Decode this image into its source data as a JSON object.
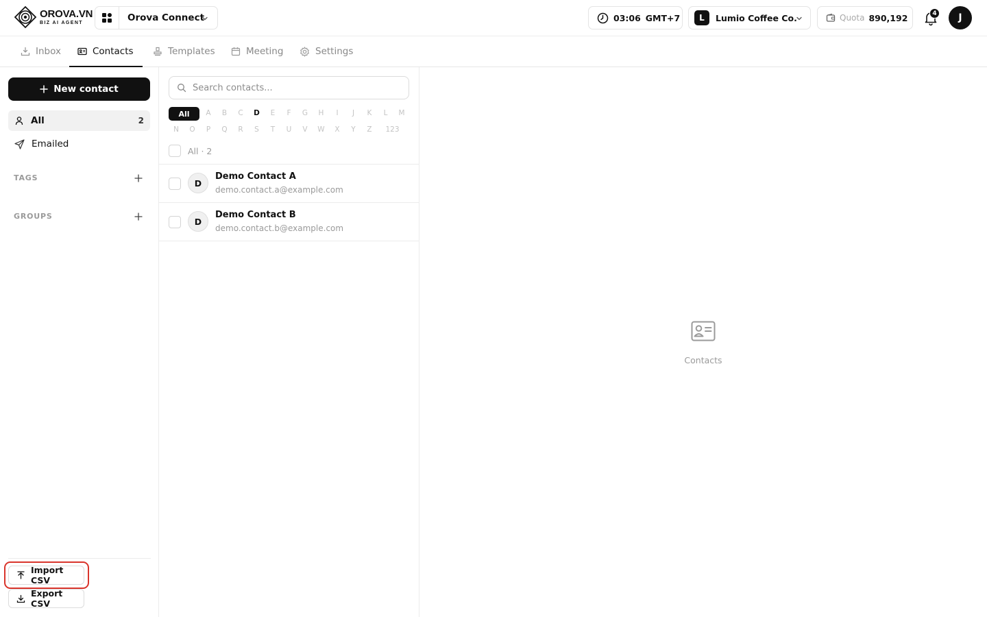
{
  "brand": {
    "name": "OROVA.VN",
    "tagline": "BIZ AI AGENT"
  },
  "workspace": {
    "name": "Orova Connect"
  },
  "header": {
    "time": "03:06",
    "timezone": "GMT+7",
    "organization_initial": "L",
    "organization": "Lumio Coffee Co.",
    "quota_label": "Quota",
    "quota_value": "890,192",
    "notification_count": "4",
    "user_initial": "J"
  },
  "tabs": [
    {
      "label": "Inbox",
      "icon": "inbox-icon",
      "active": false
    },
    {
      "label": "Contacts",
      "icon": "contact-card-icon",
      "active": true
    },
    {
      "label": "Templates",
      "icon": "stamp-icon",
      "active": false
    },
    {
      "label": "Meeting",
      "icon": "calendar-icon",
      "active": false
    },
    {
      "label": "Settings",
      "icon": "gear-icon",
      "active": false
    }
  ],
  "sidebar": {
    "new_contact_label": "New contact",
    "items": [
      {
        "label": "All",
        "count": "2",
        "icon": "user-icon",
        "active": true
      },
      {
        "label": "Emailed",
        "icon": "send-icon",
        "active": false
      }
    ],
    "sections": [
      {
        "label": "TAGS"
      },
      {
        "label": "GROUPS"
      }
    ],
    "import_label": "Import CSV",
    "export_label": "Export CSV"
  },
  "contacts": {
    "search_placeholder": "Search contacts...",
    "alphabet_all_label": "All",
    "alphabet_row1": [
      "A",
      "B",
      "C",
      "D",
      "E",
      "F",
      "G",
      "H",
      "I",
      "J",
      "K",
      "L",
      "M"
    ],
    "alphabet_row2": [
      "N",
      "O",
      "P",
      "Q",
      "R",
      "S",
      "T",
      "U",
      "V",
      "W",
      "X",
      "Y",
      "Z",
      "123"
    ],
    "alphabet_active": [
      "D"
    ],
    "select_all_label": "All · 2",
    "items": [
      {
        "initial": "D",
        "name": "Demo Contact A",
        "email": "demo.contact.a@example.com"
      },
      {
        "initial": "D",
        "name": "Demo Contact B",
        "email": "demo.contact.b@example.com"
      }
    ]
  },
  "detail": {
    "empty_label": "Contacts"
  },
  "colors": {
    "primary": "#111111",
    "muted_text": "#9a9a9a",
    "highlight": "#d9342b"
  }
}
